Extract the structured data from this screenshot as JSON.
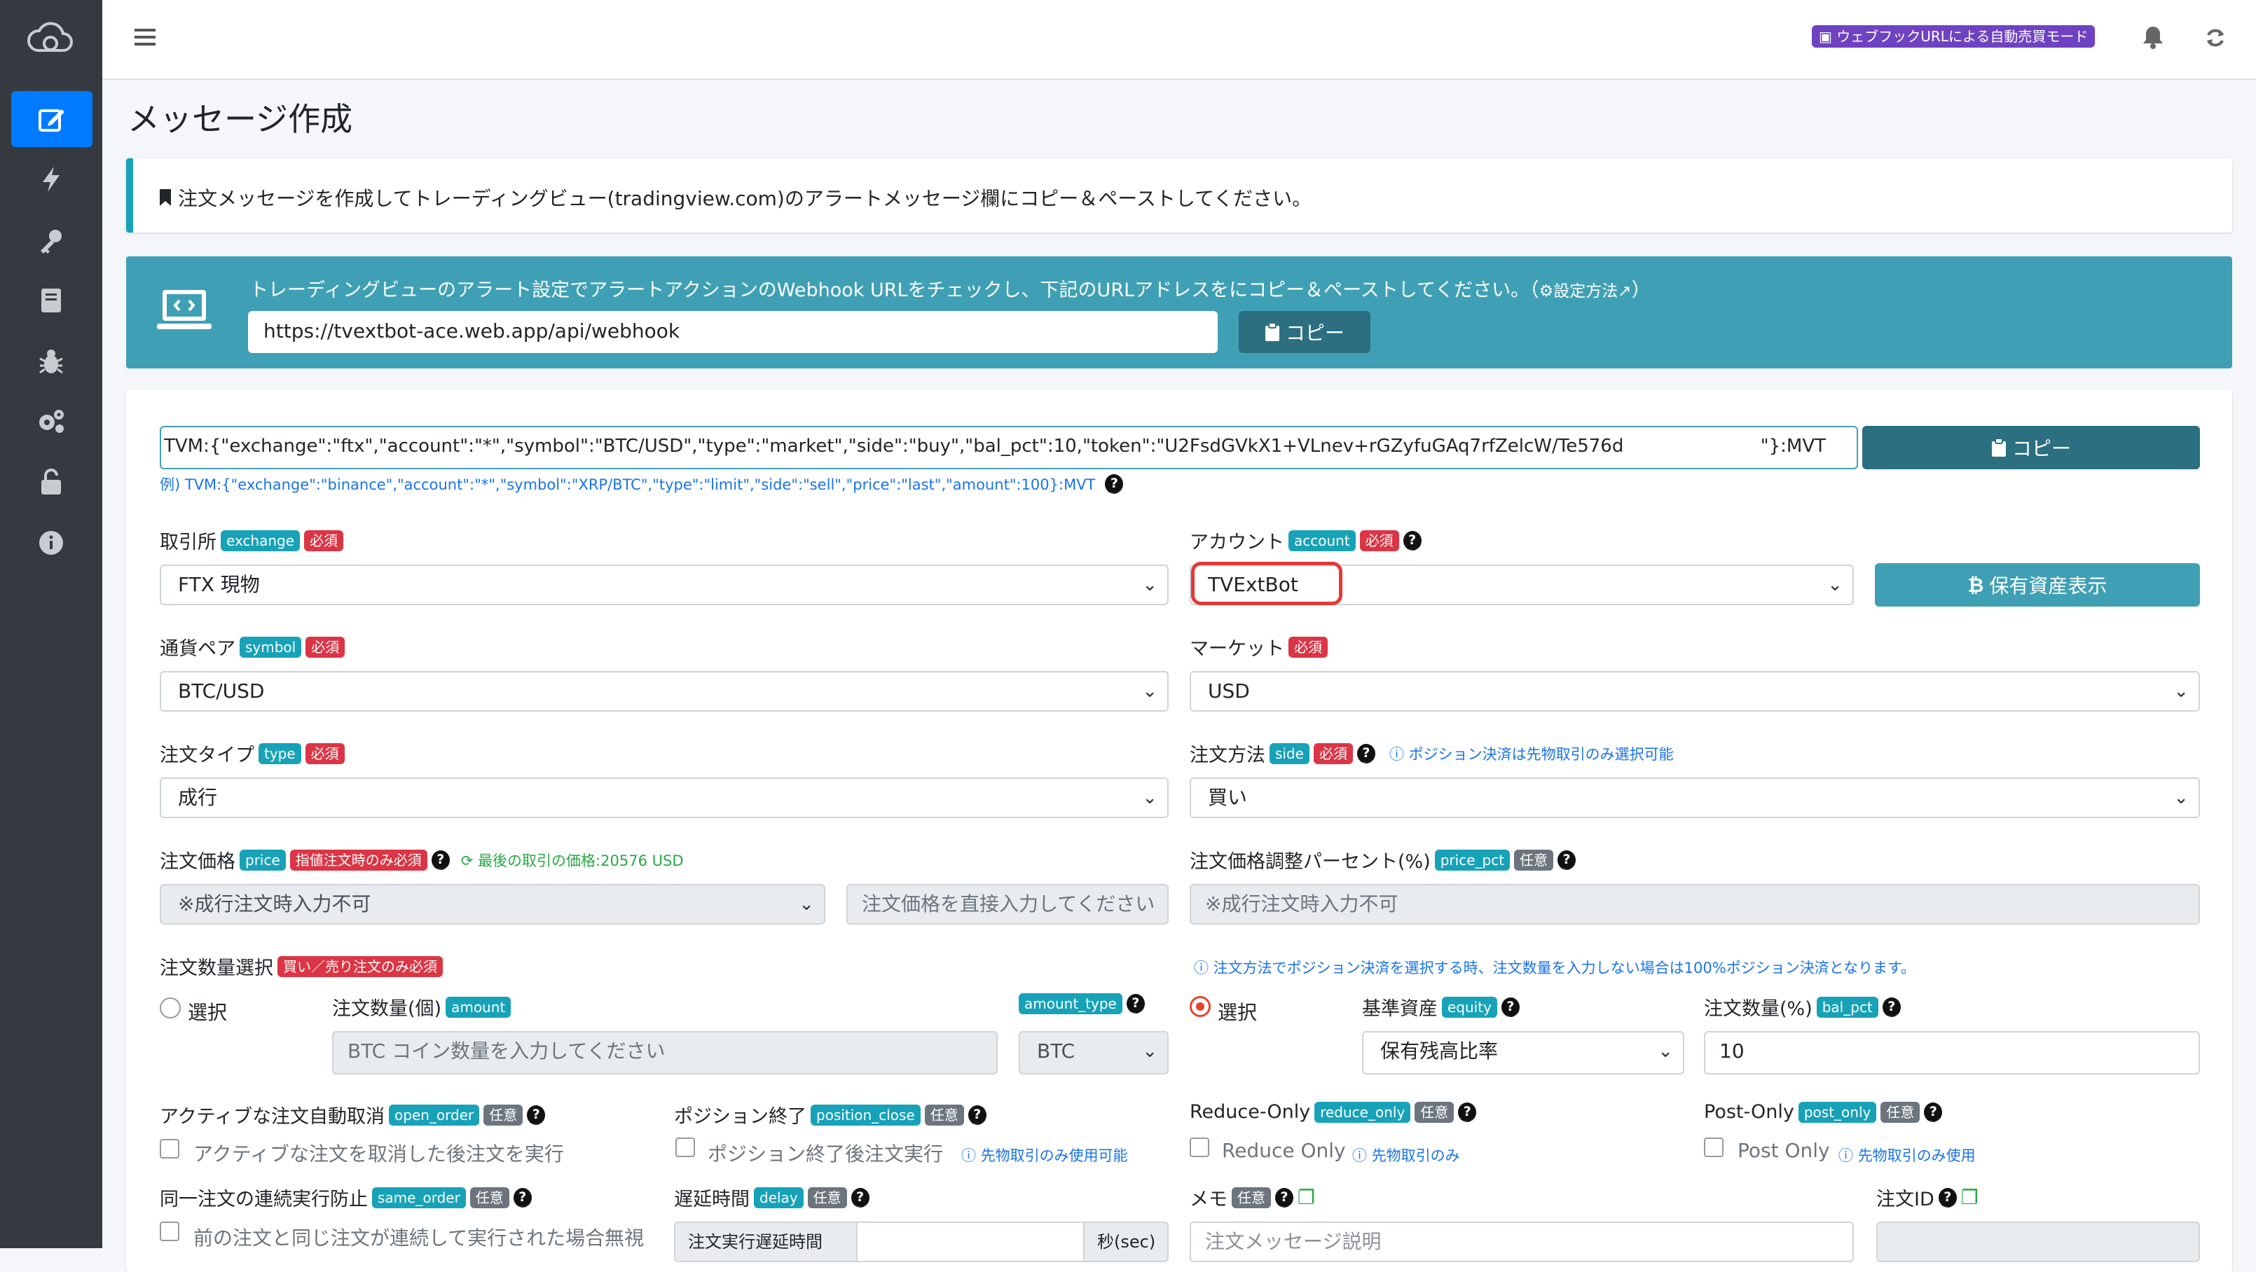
{
  "header": {
    "mode_badge": "ウェブフックURLによる自動売買モード"
  },
  "page_title": "メッセージ作成",
  "info_callout": "注文メッセージを作成してトレーディングビュー(tradingview.com)のアラートメッセージ欄にコピー＆ペーストしてください。",
  "webhook": {
    "instruction": "トレーディングビューのアラート設定でアラートアクションのWebhook URLをチェックし、下記のURLアドレスをにコピー＆ペーストしてください。（",
    "settings_link": "設定方法",
    "close_paren": "）",
    "url": "https://tvextbot-ace.web.app/api/webhook",
    "copy_label": "コピー"
  },
  "message": {
    "value_left": "TVM:{\"exchange\":\"ftx\",\"account\":\"*\",\"symbol\":\"BTC/USD\",\"type\":\"market\",\"side\":\"buy\",\"bal_pct\":10,\"token\":\"U2FsdGVkX1+VLnev+rGZyfuGAq7rfZelcW/Te576d",
    "value_right": "\"}:MVT",
    "copy_label": "コピー",
    "example": "例) TVM:{\"exchange\":\"binance\",\"account\":\"*\",\"symbol\":\"XRP/BTC\",\"type\":\"limit\",\"side\":\"sell\",\"price\":\"last\",\"amount\":100}:MVT"
  },
  "fields": {
    "exchange": {
      "label": "取引所",
      "key": "exchange",
      "req": "必須",
      "value": "FTX 現物"
    },
    "account": {
      "label": "アカウント",
      "key": "account",
      "req": "必須",
      "value": "TVExtBot",
      "button": "保有資産表示"
    },
    "symbol": {
      "label": "通貨ペア",
      "key": "symbol",
      "req": "必須",
      "value": "BTC/USD"
    },
    "market": {
      "label": "マーケット",
      "req": "必須",
      "value": "USD"
    },
    "type": {
      "label": "注文タイプ",
      "key": "type",
      "req": "必須",
      "value": "成行"
    },
    "side": {
      "label": "注文方法",
      "key": "side",
      "req": "必須",
      "value": "買い",
      "note": "ポジション決済は先物取引のみ選択可能"
    },
    "price": {
      "label": "注文価格",
      "key": "price",
      "req": "指値注文時のみ必須",
      "last_price": "最後の取引の価格:20576 USD",
      "select_value": "※成行注文時入力不可",
      "input_placeholder": "注文価格を直接入力してください"
    },
    "price_pct": {
      "label": "注文価格調整パーセント(%)",
      "key": "price_pct",
      "req": "任意",
      "value": "※成行注文時入力不可"
    },
    "qty_select": {
      "label": "注文数量選択",
      "req": "買い／売り注文のみ必須"
    },
    "qty_note": "注文方法でポジション決済を選択する時、注文数量を入力しない場合は100%ポジション決済となります。",
    "radio_label": "選択",
    "amount": {
      "label": "注文数量(個)",
      "key": "amount",
      "placeholder": "BTC コイン数量を入力してください"
    },
    "amount_type": {
      "key": "amount_type",
      "value": "BTC"
    },
    "equity": {
      "label": "基準資産",
      "key": "equity",
      "value": "保有残高比率"
    },
    "bal_pct": {
      "label": "注文数量(%)",
      "key": "bal_pct",
      "value": "10"
    },
    "open_order": {
      "label": "アクティブな注文自動取消",
      "key": "open_order",
      "req": "任意",
      "check": "アクティブな注文を取消した後注文を実行"
    },
    "position_close": {
      "label": "ポジション終了",
      "key": "position_close",
      "req": "任意",
      "check": "ポジション終了後注文実行",
      "note": "先物取引のみ使用可能"
    },
    "reduce_only": {
      "label": "Reduce-Only",
      "key": "reduce_only",
      "req": "任意",
      "check": "Reduce Only",
      "note": "先物取引のみ"
    },
    "post_only": {
      "label": "Post-Only",
      "key": "post_only",
      "req": "任意",
      "check": "Post Only",
      "note": "先物取引のみ使用"
    },
    "same_order": {
      "label": "同一注文の連続実行防止",
      "key": "same_order",
      "req": "任意",
      "check": "前の注文と同じ注文が連続して実行された場合無視"
    },
    "delay": {
      "label": "遅延時間",
      "key": "delay",
      "req": "任意",
      "prefix": "注文実行遅延時間",
      "suffix": "秒(sec)"
    },
    "memo": {
      "label": "メモ",
      "req": "任意",
      "placeholder": "注文メッセージ説明"
    },
    "order_id": {
      "label": "注文ID"
    }
  },
  "colors": {
    "sidebar": "#343a40",
    "active": "#007bff",
    "teal": "#3fa0b5",
    "badge_info": "#17a2b8",
    "badge_required": "#dc3545"
  }
}
